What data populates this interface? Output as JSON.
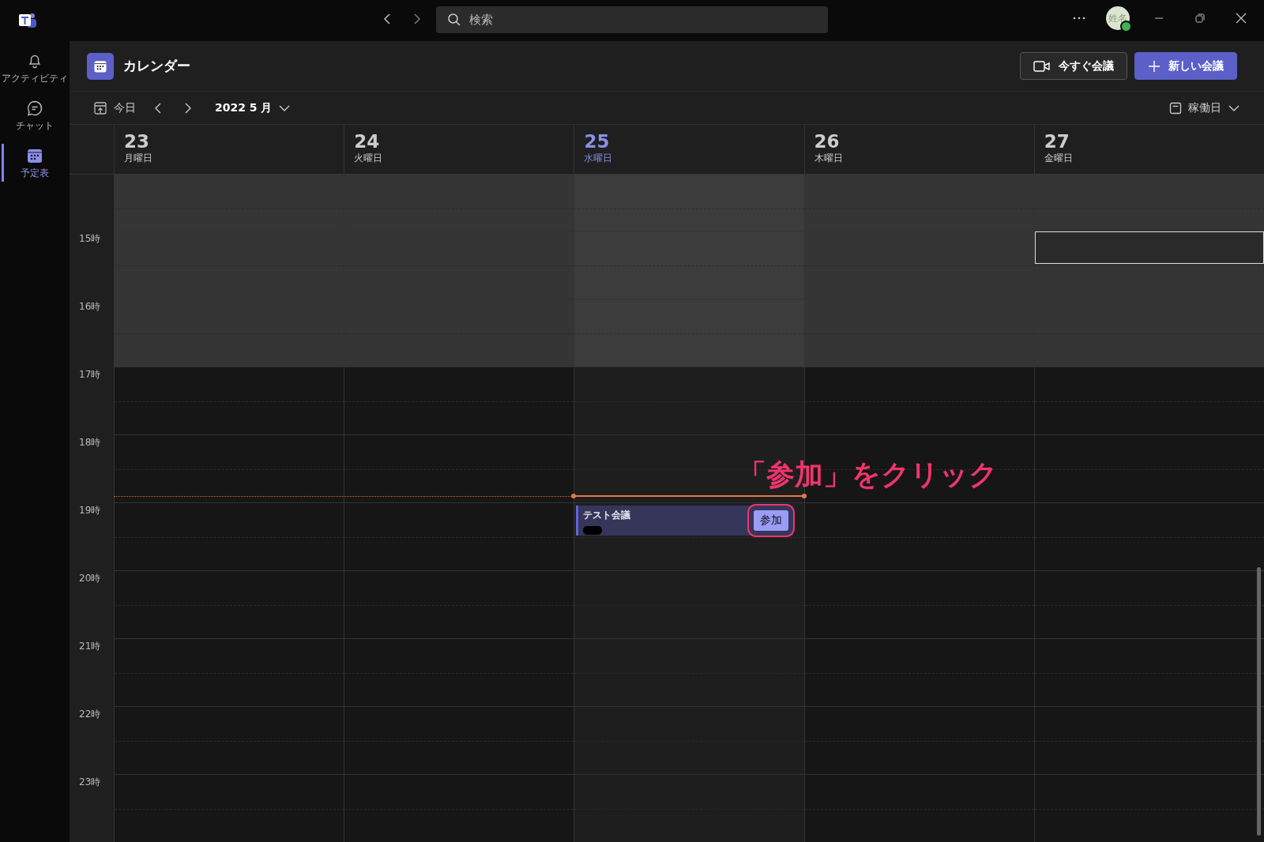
{
  "title_bar": {
    "search": {
      "placeholder": "検索"
    },
    "avatar": "姓名"
  },
  "sidebar": {
    "items": [
      {
        "label": "アクティビティ",
        "selected": false
      },
      {
        "label": "チャット",
        "selected": false
      },
      {
        "label": "予定表",
        "selected": true
      }
    ]
  },
  "header": {
    "title": "カレンダー",
    "meet_now": "今すぐ会議",
    "new_meeting": "新しい会議"
  },
  "toolbar": {
    "today": "今日",
    "month": "2022 5 月",
    "view": "稼働日"
  },
  "days": [
    {
      "date": "23",
      "weekday": "月曜日",
      "today": false,
      "selected_slot": false
    },
    {
      "date": "24",
      "weekday": "火曜日",
      "today": false,
      "selected_slot": false
    },
    {
      "date": "25",
      "weekday": "水曜日",
      "today": true,
      "selected_slot": false,
      "events": [
        {
          "title": "テスト会議",
          "join": "参加",
          "highlighted": true
        }
      ]
    },
    {
      "date": "26",
      "weekday": "木曜日",
      "today": false,
      "selected_slot": false
    },
    {
      "date": "27",
      "weekday": "金曜日",
      "today": false,
      "selected_slot": true
    }
  ],
  "hours": [
    {
      "label": "15時",
      "working_hours": true,
      "now": false
    },
    {
      "label": "16時",
      "working_hours": true,
      "now": false
    },
    {
      "label": "17時",
      "working_hours": false,
      "now": false
    },
    {
      "label": "18時",
      "working_hours": false,
      "now": true
    },
    {
      "label": "19時",
      "working_hours": false,
      "now": false
    },
    {
      "label": "20時",
      "working_hours": false,
      "now": false
    },
    {
      "label": "21時",
      "working_hours": false,
      "now": false
    },
    {
      "label": "22時",
      "working_hours": false,
      "now": false
    },
    {
      "label": "23時",
      "working_hours": false,
      "now": false
    }
  ],
  "annotation": "「参加」をクリック"
}
